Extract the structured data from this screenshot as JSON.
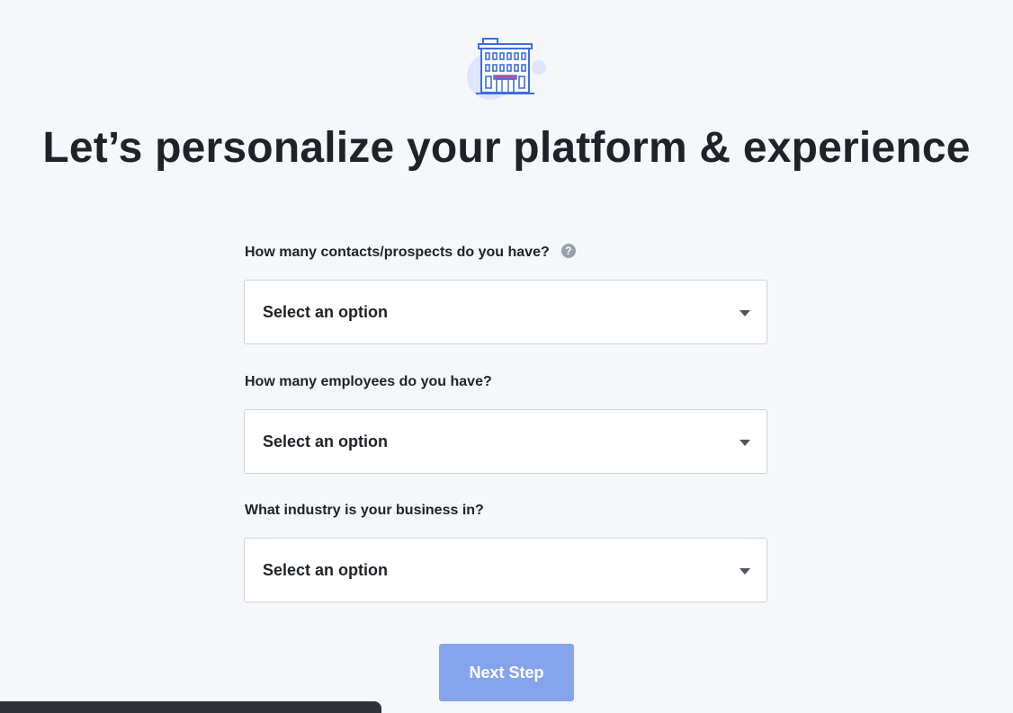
{
  "hero": {
    "icon": "office-building-icon",
    "accent_color": "#3d6ee0",
    "circle_color": "#dfe6fb",
    "door_color": "#e0457b"
  },
  "title": "Let’s personalize your platform & experience",
  "fields": [
    {
      "label": "How many contacts/prospects do you have?",
      "has_help_icon": true,
      "help_icon_glyph": "?",
      "value": "Select an option"
    },
    {
      "label": "How many employees do you have?",
      "has_help_icon": false,
      "value": "Select an option"
    },
    {
      "label": "What industry is your business in?",
      "has_help_icon": false,
      "value": "Select an option"
    }
  ],
  "next_button": {
    "label": "Next Step",
    "background": "#86a4ee"
  }
}
